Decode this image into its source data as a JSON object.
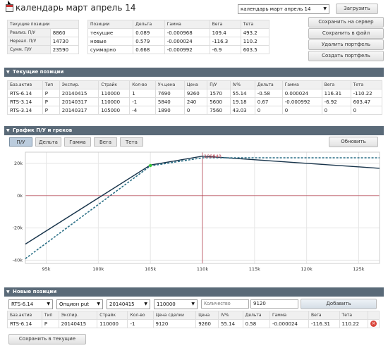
{
  "title": "календарь март апрель 14",
  "portfolio_select": "календарь март апрель 14",
  "buttons": {
    "load": "Загрузить",
    "save_server": "Сохранить на сервер",
    "save_file": "Сохранить в файл",
    "delete": "Удалить портфель",
    "create": "Создать портфель",
    "refresh": "Обновить",
    "add": "Добавить",
    "save_current": "Сохранить в текущие"
  },
  "summary": {
    "header": "Текущие позиции",
    "rows": [
      {
        "label": "Реализ. П/У",
        "value": "8860"
      },
      {
        "label": "Нереал. П/У",
        "value": "14730"
      },
      {
        "label": "Сумм. П/У",
        "value": "23590"
      }
    ]
  },
  "greeks": {
    "headers": [
      "Позиции",
      "Дельта",
      "Гамма",
      "Вега",
      "Тета"
    ],
    "rows": [
      [
        "текущие",
        "0.089",
        "-0.000968",
        "109.4",
        "493.2"
      ],
      [
        "новые",
        "0.579",
        "-0.000024",
        "-116.3",
        "110.2"
      ],
      [
        "суммарно",
        "0.668",
        "-0.000992",
        "-6.9",
        "603.5"
      ]
    ]
  },
  "current_positions": {
    "title": "Текущие позиции",
    "headers": [
      "Баз.актив",
      "Тип",
      "Экспир.",
      "Страйк",
      "Кол-во",
      "Уч.цена",
      "Цена",
      "П/У",
      "IV%",
      "Дельта",
      "Гамма",
      "Вега",
      "Тета"
    ],
    "rows": [
      [
        "RTS-6.14",
        "P",
        "20140415",
        "110000",
        "1",
        "7690",
        "9260",
        "1570",
        "55.14",
        "-0.58",
        "0.000024",
        "116.31",
        "-110.22"
      ],
      [
        "RTS-3.14",
        "P",
        "20140317",
        "110000",
        "-1",
        "5840",
        "240",
        "5600",
        "19.18",
        "0.67",
        "-0.000992",
        "-6.92",
        "603.47"
      ],
      [
        "RTS-3.14",
        "P",
        "20140317",
        "105000",
        "-4",
        "1890",
        "0",
        "7560",
        "43.03",
        "0",
        "0",
        "0",
        "0"
      ]
    ]
  },
  "chart_section": {
    "title": "График П/У и греков",
    "tabs": [
      "П/У",
      "Дельта",
      "Гамма",
      "Вега",
      "Тета"
    ],
    "active_tab": "П/У"
  },
  "chart_data": {
    "type": "line",
    "x_ticks": [
      "95k",
      "100k",
      "105k",
      "110k",
      "115k",
      "120k",
      "125k"
    ],
    "y_ticks": [
      "20k",
      "0k",
      "-20k",
      "-40k"
    ],
    "xlim": [
      93000,
      127000
    ],
    "ylim": [
      -42000,
      27000
    ],
    "marker": {
      "x": 110000,
      "label": "109840"
    },
    "series": [
      {
        "points": [
          [
            93000,
            -30000
          ],
          [
            105000,
            19000
          ],
          [
            110000,
            24500
          ],
          [
            127000,
            17000
          ]
        ],
        "color": "#17334a",
        "style": "solid"
      },
      {
        "points": [
          [
            93000,
            -39000
          ],
          [
            105000,
            18500
          ],
          [
            110000,
            23500
          ],
          [
            127000,
            23500
          ]
        ],
        "color": "#2a6f86",
        "style": "dashed"
      }
    ]
  },
  "new_positions": {
    "title": "Новые позиции",
    "form": {
      "asset": "RTS-6.14",
      "type": "Опцион put",
      "expiry": "20140415",
      "strike": "110000",
      "qty_placeholder": "Количество",
      "price": "9120"
    },
    "headers": [
      "Баз.актив",
      "Тип",
      "Экспир.",
      "Страйк",
      "Кол-во",
      "Цена сделки",
      "Цена",
      "IV%",
      "Дельта",
      "Гамма",
      "Вега",
      "Тета"
    ],
    "rows": [
      [
        "RTS-6.14",
        "P",
        "20140415",
        "110000",
        "-1",
        "9120",
        "9260",
        "55.14",
        "0.58",
        "-0.000024",
        "-116.31",
        "110.22"
      ]
    ]
  },
  "colors": {
    "header_bar": "#5a6a78",
    "line_main": "#17334a",
    "line_dashed": "#2a6f86",
    "marker": "#b03040",
    "delete": "#d9443a"
  }
}
